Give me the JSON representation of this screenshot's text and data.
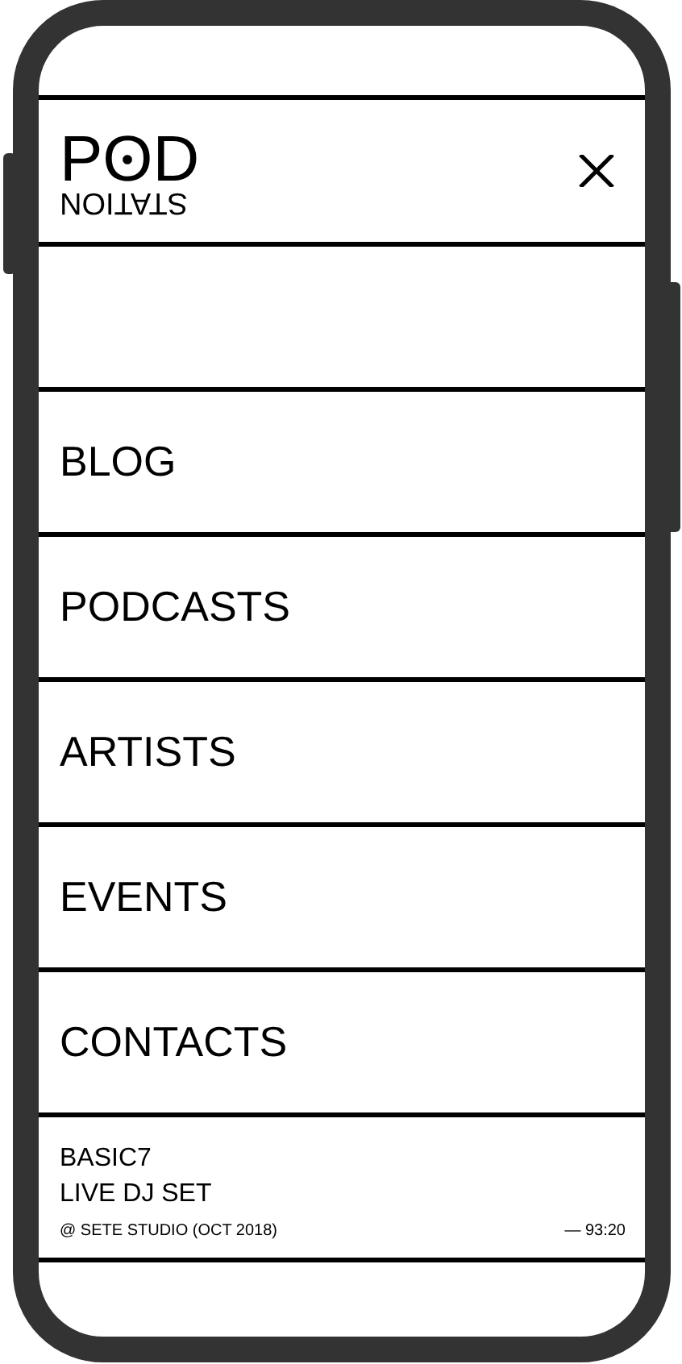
{
  "logo": {
    "title": "POD",
    "subtitle": "STATION"
  },
  "menu": [
    {
      "label": "BLOG"
    },
    {
      "label": "PODCASTS"
    },
    {
      "label": "ARTISTS"
    },
    {
      "label": "EVENTS"
    },
    {
      "label": "CONTACTS"
    }
  ],
  "now_playing": {
    "title": "BASIC7",
    "subtitle": "LIVE DJ SET",
    "venue": "@ SETE STUDIO (OCT 2018)",
    "duration": "— 93:20"
  }
}
